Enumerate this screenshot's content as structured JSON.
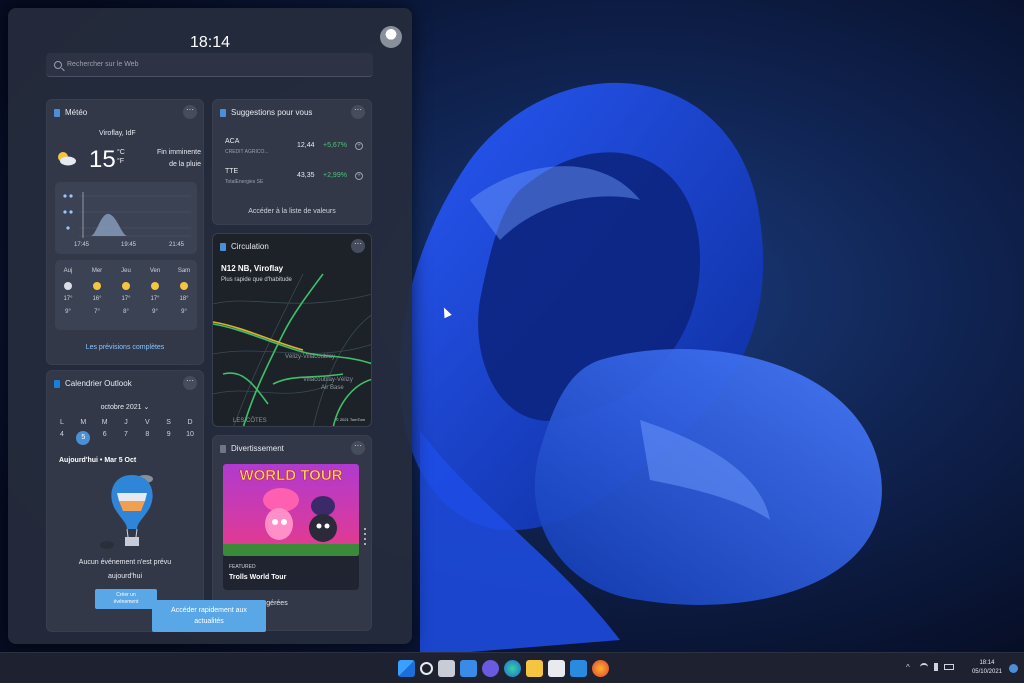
{
  "panel": {
    "time": "18:14",
    "search_placeholder": "Rechercher sur le Web"
  },
  "weather": {
    "title": "Météo",
    "location": "Viroflay, IdF",
    "temperature": "15",
    "unit_c": "°C",
    "unit_f": "°F",
    "condition_line1": "Fin imminente",
    "condition_line2": "de la pluie",
    "time_ticks": [
      "17:45",
      "19:45",
      "21:45"
    ],
    "days": [
      {
        "name": "Auj",
        "high": "17°",
        "low": "9°"
      },
      {
        "name": "Mer",
        "high": "16°",
        "low": "7°"
      },
      {
        "name": "Jeu",
        "high": "17°",
        "low": "8°"
      },
      {
        "name": "Ven",
        "high": "17°",
        "low": "9°"
      },
      {
        "name": "Sam",
        "high": "18°",
        "low": "9°"
      }
    ],
    "link": "Les prévisions complètes"
  },
  "stocks": {
    "title": "Suggestions pour vous",
    "items": [
      {
        "symbol": "ACA",
        "name": "CREDIT AGRICO...",
        "price": "12,44",
        "change": "+5,67%"
      },
      {
        "symbol": "TTE",
        "name": "TotalEnergies SE",
        "price": "43,35",
        "change": "+2,99%"
      }
    ],
    "link": "Accéder à la liste de valeurs"
  },
  "traffic": {
    "title": "Circulation",
    "route": "N12 NB, Viroflay",
    "note": "Plus rapide que d'habitude",
    "copyright": "© 2021 TomTom"
  },
  "calendar": {
    "title": "Calendrier Outlook",
    "month": "octobre 2021",
    "weekdays": [
      "L",
      "M",
      "M",
      "J",
      "V",
      "S",
      "D"
    ],
    "dates": [
      "4",
      "5",
      "6",
      "7",
      "8",
      "9",
      "10"
    ],
    "today_heading": "Aujourd'hui • Mar 5 Oct",
    "empty_msg_line1": "Aucun événement n'est prévu",
    "empty_msg_line2": "aujourd'hui",
    "button_line1": "Créer un",
    "button_line2": "événement"
  },
  "entertainment": {
    "title": "Divertissement",
    "poster_text": "WORLD TOUR",
    "tag": "FEATURED",
    "movie": "Trolls World Tour",
    "footer": "suggérées"
  },
  "tooltip": {
    "line1": "Accéder rapidement aux",
    "line2": "actualités"
  },
  "taskbar": {
    "time": "18:14",
    "date": "05/10/2021"
  },
  "colors": {
    "accent": "#4a8fd8",
    "positive": "#4ec07a",
    "link": "#8cc3ff"
  }
}
